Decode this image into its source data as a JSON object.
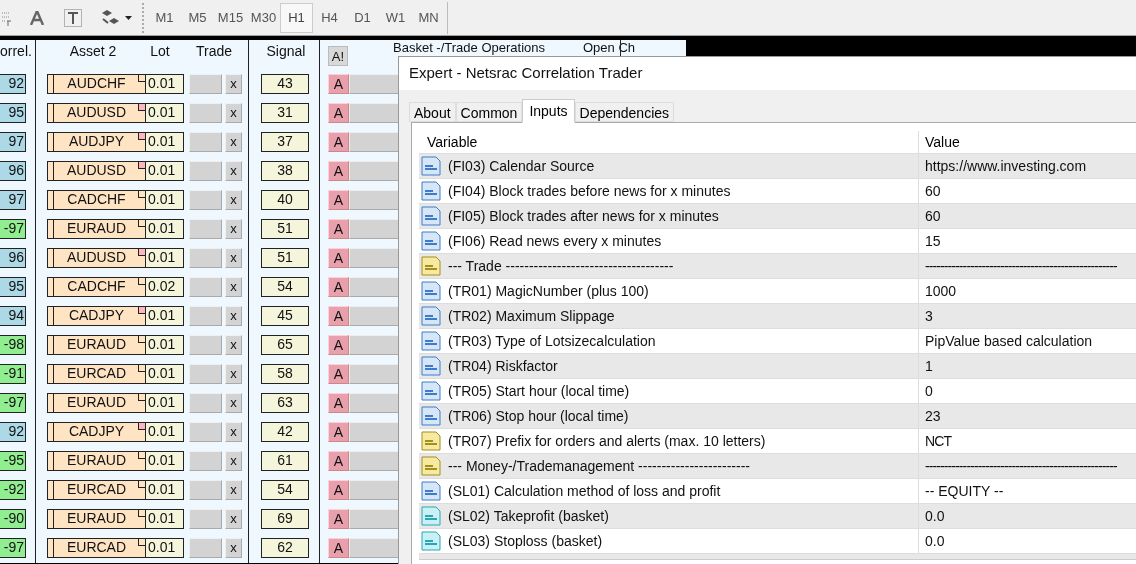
{
  "toolbar": {
    "timeframes": [
      {
        "label": "M1",
        "selected": false
      },
      {
        "label": "M5",
        "selected": false
      },
      {
        "label": "M15",
        "selected": false
      },
      {
        "label": "M30",
        "selected": false
      },
      {
        "label": "H1",
        "selected": true
      },
      {
        "label": "H4",
        "selected": false
      },
      {
        "label": "D1",
        "selected": false
      },
      {
        "label": "W1",
        "selected": false
      },
      {
        "label": "MN",
        "selected": false
      }
    ]
  },
  "panel": {
    "headers": {
      "correl": "orrel.",
      "asset": "Asset 2",
      "lot": "Lot",
      "trade": "Trade",
      "signal": "Signal",
      "alert_all": "A!",
      "basket": "Basket -/Trade Operations",
      "open": "Open Ch"
    },
    "rows": [
      {
        "correl": "92",
        "color": "#add8e6",
        "asset": "AUDCHF",
        "flagged": false,
        "lot": "0.01",
        "close": "x",
        "signal": "43",
        "alert": "A"
      },
      {
        "correl": "95",
        "color": "#add8e6",
        "asset": "AUDUSD",
        "flagged": true,
        "lot": "0.01",
        "close": "x",
        "signal": "31",
        "alert": "A"
      },
      {
        "correl": "97",
        "color": "#add8e6",
        "asset": "AUDJPY",
        "flagged": true,
        "lot": "0.01",
        "close": "x",
        "signal": "37",
        "alert": "A"
      },
      {
        "correl": "96",
        "color": "#add8e6",
        "asset": "AUDUSD",
        "flagged": true,
        "lot": "0.01",
        "close": "x",
        "signal": "38",
        "alert": "A"
      },
      {
        "correl": "97",
        "color": "#add8e6",
        "asset": "CADCHF",
        "flagged": false,
        "lot": "0.01",
        "close": "x",
        "signal": "40",
        "alert": "A"
      },
      {
        "correl": "-97",
        "color": "#90ee90",
        "asset": "EURAUD",
        "flagged": false,
        "lot": "0.01",
        "close": "x",
        "signal": "51",
        "alert": "A"
      },
      {
        "correl": "96",
        "color": "#add8e6",
        "asset": "AUDUSD",
        "flagged": true,
        "lot": "0.01",
        "close": "x",
        "signal": "51",
        "alert": "A"
      },
      {
        "correl": "95",
        "color": "#add8e6",
        "asset": "CADCHF",
        "flagged": false,
        "lot": "0.02",
        "close": "x",
        "signal": "54",
        "alert": "A"
      },
      {
        "correl": "94",
        "color": "#add8e6",
        "asset": "CADJPY",
        "flagged": true,
        "lot": "0.01",
        "close": "x",
        "signal": "45",
        "alert": "A"
      },
      {
        "correl": "-98",
        "color": "#90ee90",
        "asset": "EURAUD",
        "flagged": false,
        "lot": "0.01",
        "close": "x",
        "signal": "65",
        "alert": "A"
      },
      {
        "correl": "-91",
        "color": "#90ee90",
        "asset": "EURCAD",
        "flagged": false,
        "lot": "0.01",
        "close": "x",
        "signal": "58",
        "alert": "A"
      },
      {
        "correl": "-97",
        "color": "#90ee90",
        "asset": "EURAUD",
        "flagged": false,
        "lot": "0.01",
        "close": "x",
        "signal": "63",
        "alert": "A"
      },
      {
        "correl": "92",
        "color": "#add8e6",
        "asset": "CADJPY",
        "flagged": true,
        "lot": "0.01",
        "close": "x",
        "signal": "42",
        "alert": "A"
      },
      {
        "correl": "-95",
        "color": "#90ee90",
        "asset": "EURAUD",
        "flagged": false,
        "lot": "0.01",
        "close": "x",
        "signal": "61",
        "alert": "A"
      },
      {
        "correl": "-92",
        "color": "#90ee90",
        "asset": "EURCAD",
        "flagged": false,
        "lot": "0.01",
        "close": "x",
        "signal": "54",
        "alert": "A"
      },
      {
        "correl": "-90",
        "color": "#90ee90",
        "asset": "EURAUD",
        "flagged": false,
        "lot": "0.01",
        "close": "x",
        "signal": "69",
        "alert": "A"
      },
      {
        "correl": "-97",
        "color": "#90ee90",
        "asset": "EURCAD",
        "flagged": false,
        "lot": "0.01",
        "close": "x",
        "signal": "62",
        "alert": "A"
      }
    ]
  },
  "dialog": {
    "title": "Expert - Netsrac Correlation Trader",
    "tabs": [
      {
        "label": "About",
        "selected": false
      },
      {
        "label": "Common",
        "selected": false
      },
      {
        "label": "Inputs",
        "selected": true
      },
      {
        "label": "Dependencies",
        "selected": false
      }
    ],
    "table": {
      "columns": [
        "Variable",
        "Value"
      ],
      "rows": [
        {
          "kind": "int",
          "variable": "(FI03) Calendar Source",
          "value": "https://www.investing.com"
        },
        {
          "kind": "int",
          "variable": "(FI04) Block trades before news for x minutes",
          "value": "60"
        },
        {
          "kind": "int",
          "variable": "(FI05) Block trades after news for x minutes",
          "value": "60"
        },
        {
          "kind": "int",
          "variable": "(FI06) Read news every x minutes",
          "value": "15"
        },
        {
          "kind": "string",
          "variable": "--- Trade ------------------------------------",
          "value": "---------------------------------------------------"
        },
        {
          "kind": "int",
          "variable": "(TR01) MagicNumber (plus 100)",
          "value": "1000"
        },
        {
          "kind": "int",
          "variable": "(TR02) Maximum Slippage",
          "value": "3"
        },
        {
          "kind": "int",
          "variable": "(TR03) Type of Lotsizecalculation",
          "value": "PipValue based calculation"
        },
        {
          "kind": "int",
          "variable": "(TR04) Riskfactor",
          "value": "1"
        },
        {
          "kind": "int",
          "variable": "(TR05) Start hour (local time)",
          "value": "0"
        },
        {
          "kind": "int",
          "variable": "(TR06) Stop hour (local time)",
          "value": "23"
        },
        {
          "kind": "string",
          "variable": "(TR07) Prefix for orders and alerts (max. 10 letters)",
          "value": "NCT"
        },
        {
          "kind": "string",
          "variable": "--- Money-/Trademanagement ------------------------",
          "value": "---------------------------------------------------"
        },
        {
          "kind": "int",
          "variable": "(SL01) Calculation method of loss and profit",
          "value": "-- EQUITY --"
        },
        {
          "kind": "double",
          "variable": "(SL02) Takeprofit (basket)",
          "value": "0.0"
        },
        {
          "kind": "double",
          "variable": "(SL03) Stoploss (basket)",
          "value": "0.0"
        }
      ]
    }
  }
}
